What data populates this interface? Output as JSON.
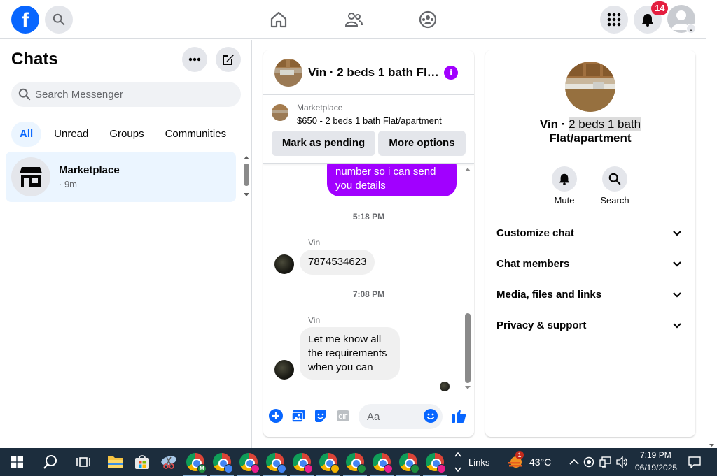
{
  "topbar": {
    "logo_letter": "f",
    "notifications_count": "14",
    "icons": [
      "facebook-logo",
      "search-icon",
      "home-icon",
      "friends-icon",
      "groups-icon",
      "menu-grid-icon",
      "bell-icon",
      "profile-avatar"
    ]
  },
  "left": {
    "title": "Chats",
    "search_placeholder": "Search Messenger",
    "filters": [
      "All",
      "Unread",
      "Groups",
      "Communities"
    ],
    "chat": {
      "name": "Marketplace",
      "time": "· 9m"
    }
  },
  "chat": {
    "header_title": "Vin · 2 beds 1 bath Flat/apartment",
    "marketplace": {
      "label": "Marketplace",
      "price_line": "$650 - 2 beds 1 bath Flat/apartment",
      "btn_pending": "Mark as pending",
      "btn_more": "More options"
    },
    "messages": {
      "sent_partial": "number so i can send you details",
      "time1": "5:18 PM",
      "sender1": "Vin",
      "msg1": "7874534623",
      "time2": "7:08 PM",
      "sender2": "Vin",
      "msg2": "Let me know all the requirements when you can"
    },
    "input_placeholder": "Aa"
  },
  "right": {
    "name_prefix": "Vin · ",
    "name_highlight": "2 beds 1 bath",
    "name_line2": "Flat/apartment",
    "actions": [
      "Mute",
      "Search"
    ],
    "sections": [
      "Customize chat",
      "Chat members",
      "Media, files and links",
      "Privacy & support"
    ]
  },
  "taskbar": {
    "links_label": "Links",
    "temperature": "43°C",
    "weather_badge": "1",
    "time": "7:19 PM",
    "date": "06/19/2025",
    "chrome_profiles": [
      {
        "letter": "M",
        "color": "#1e8e3e"
      },
      {
        "letter": "",
        "color": "#4285f4"
      },
      {
        "letter": "",
        "color": "#e91e8c"
      },
      {
        "letter": "",
        "color": "#4285f4"
      },
      {
        "letter": "",
        "color": "#e91e8c"
      },
      {
        "letter": "",
        "color": "#f4b400"
      },
      {
        "letter": "",
        "color": "#1e8e3e"
      },
      {
        "letter": "",
        "color": "#e91e8c"
      },
      {
        "letter": "",
        "color": "#1e8e3e"
      },
      {
        "letter": "",
        "color": "#e91e8c"
      }
    ]
  },
  "colors": {
    "brand_blue": "#0866ff",
    "messenger_purple": "#a100ff",
    "badge_red": "#e41e3f"
  }
}
